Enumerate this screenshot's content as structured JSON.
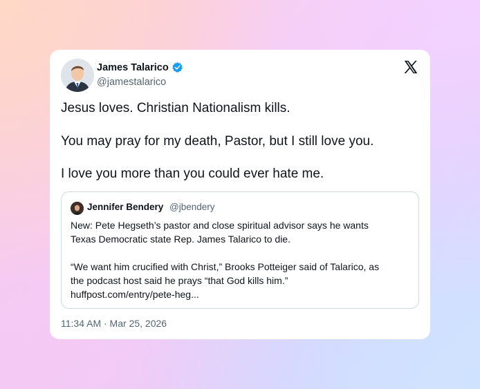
{
  "tweet": {
    "author": {
      "name": "James Talarico",
      "handle": "@jamestalarico",
      "verified": true,
      "verified_color": "#1d9bf0"
    },
    "lines": [
      "Jesus loves. Christian Nationalism kills.",
      "You may pray for my death, Pastor, but I still love you.",
      "I love you more than you could ever hate me."
    ],
    "quoted": {
      "author_name": "Jennifer Bendery",
      "author_handle": "@jbendery",
      "lines": [
        "New: Pete Hegseth’s pastor and close spiritual advisor says he wants",
        "Texas Democratic state Rep. James Talarico to die.",
        "“We want him crucified with Christ,” Brooks Potteiger said of Talarico, as",
        "the podcast host said he prays “that God kills him.”",
        "huffpost.com/entry/pete-heg..."
      ]
    },
    "timestamp": "11:34 AM · Mar 25, 2026",
    "platform_icon": "x-logo-icon"
  },
  "colors": {
    "text_primary": "#0f1419",
    "text_secondary": "#536471",
    "border": "#cfd9de",
    "card_bg": "#ffffff"
  }
}
